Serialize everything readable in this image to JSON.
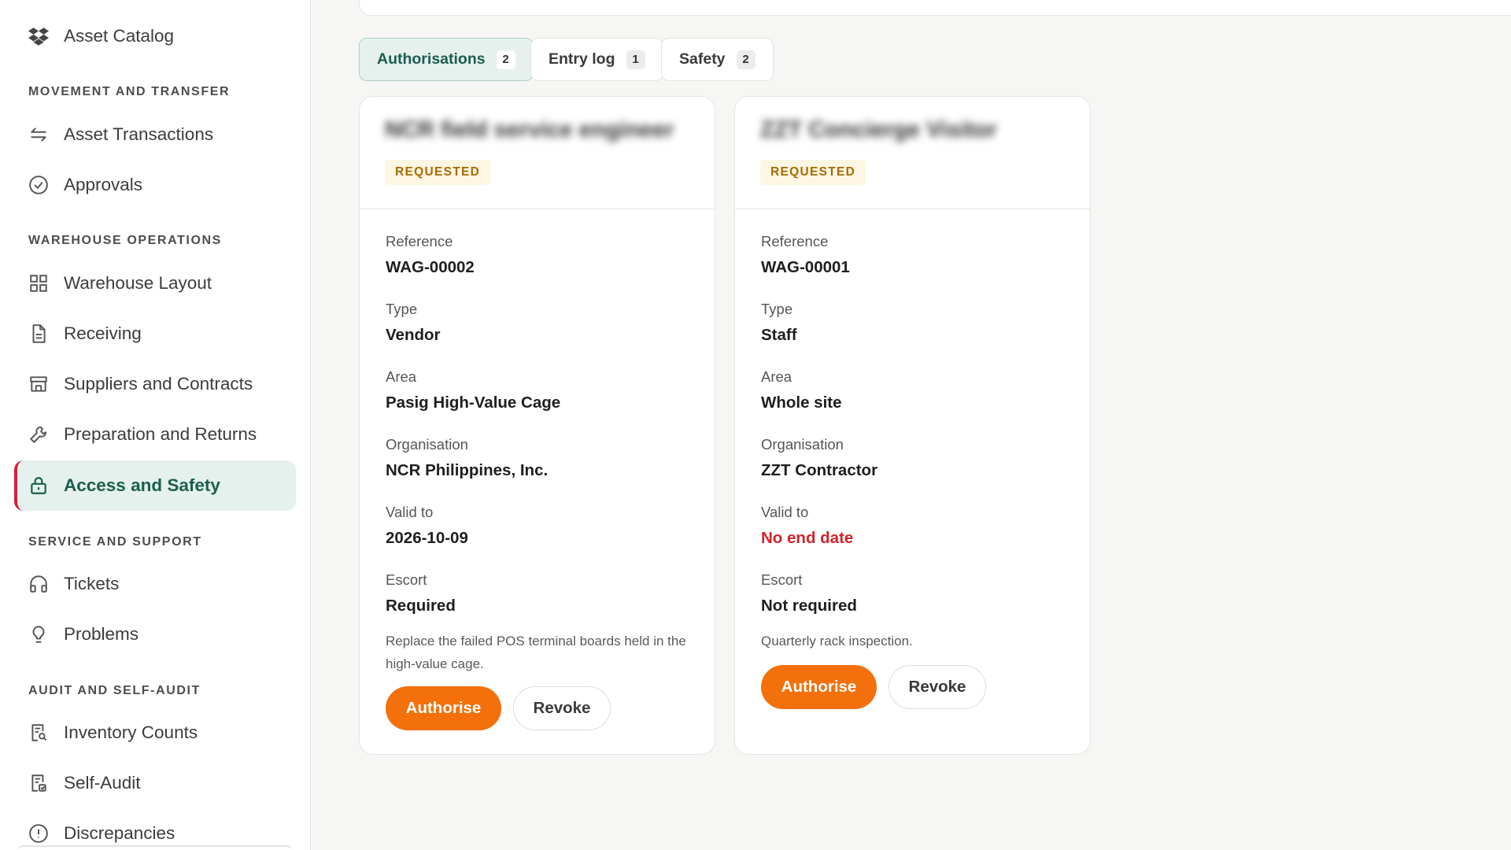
{
  "sidebar": {
    "top_item": {
      "label": "Asset Catalog",
      "icon": "dropbox-icon"
    },
    "sections": [
      {
        "label": "MOVEMENT AND TRANSFER",
        "items": [
          {
            "label": "Asset Transactions",
            "icon": "transfer-arrows-icon"
          },
          {
            "label": "Approvals",
            "icon": "check-circle-icon"
          }
        ]
      },
      {
        "label": "WAREHOUSE OPERATIONS",
        "items": [
          {
            "label": "Warehouse Layout",
            "icon": "grid-icon"
          },
          {
            "label": "Receiving",
            "icon": "document-icon"
          },
          {
            "label": "Suppliers and Contracts",
            "icon": "store-icon"
          },
          {
            "label": "Preparation and Returns",
            "icon": "wrench-icon"
          },
          {
            "label": "Access and Safety",
            "icon": "lock-icon",
            "active": true
          }
        ]
      },
      {
        "label": "SERVICE AND SUPPORT",
        "items": [
          {
            "label": "Tickets",
            "icon": "headphones-icon"
          },
          {
            "label": "Problems",
            "icon": "lightbulb-icon"
          }
        ]
      },
      {
        "label": "AUDIT AND SELF-AUDIT",
        "items": [
          {
            "label": "Inventory Counts",
            "icon": "search-document-icon"
          },
          {
            "label": "Self-Audit",
            "icon": "audit-document-icon"
          },
          {
            "label": "Discrepancies",
            "icon": "warning-circle-icon"
          }
        ]
      }
    ],
    "active_accent": "#d81f3c"
  },
  "tabs": [
    {
      "label": "Authorisations",
      "count": "2",
      "active": true
    },
    {
      "label": "Entry log",
      "count": "1"
    },
    {
      "label": "Safety",
      "count": "2"
    }
  ],
  "cards": [
    {
      "title": "NCR field service engineer",
      "status": "REQUESTED",
      "fields": [
        {
          "label": "Reference",
          "value": "WAG-00002"
        },
        {
          "label": "Type",
          "value": "Vendor"
        },
        {
          "label": "Area",
          "value": "Pasig High-Value Cage"
        },
        {
          "label": "Organisation",
          "value": "NCR Philippines, Inc."
        },
        {
          "label": "Valid to",
          "value": "2026-10-09"
        },
        {
          "label": "Escort",
          "value": "Required"
        }
      ],
      "note": "Replace the failed POS terminal boards held in the high-value cage.",
      "primary_action": "Authorise",
      "secondary_action": "Revoke"
    },
    {
      "title": "ZZT Concierge Visitor",
      "status": "REQUESTED",
      "fields": [
        {
          "label": "Reference",
          "value": "WAG-00001"
        },
        {
          "label": "Type",
          "value": "Staff"
        },
        {
          "label": "Area",
          "value": "Whole site"
        },
        {
          "label": "Organisation",
          "value": "ZZT Contractor"
        },
        {
          "label": "Valid to",
          "value": "No end date",
          "alert": true
        },
        {
          "label": "Escort",
          "value": "Not required"
        }
      ],
      "note": "Quarterly rack inspection.",
      "primary_action": "Authorise",
      "secondary_action": "Revoke"
    }
  ],
  "colors": {
    "accent_green": "#1c5e4d",
    "action_orange": "#f4700a",
    "alert_red": "#d1242a",
    "badge_text": "#a56b00"
  }
}
